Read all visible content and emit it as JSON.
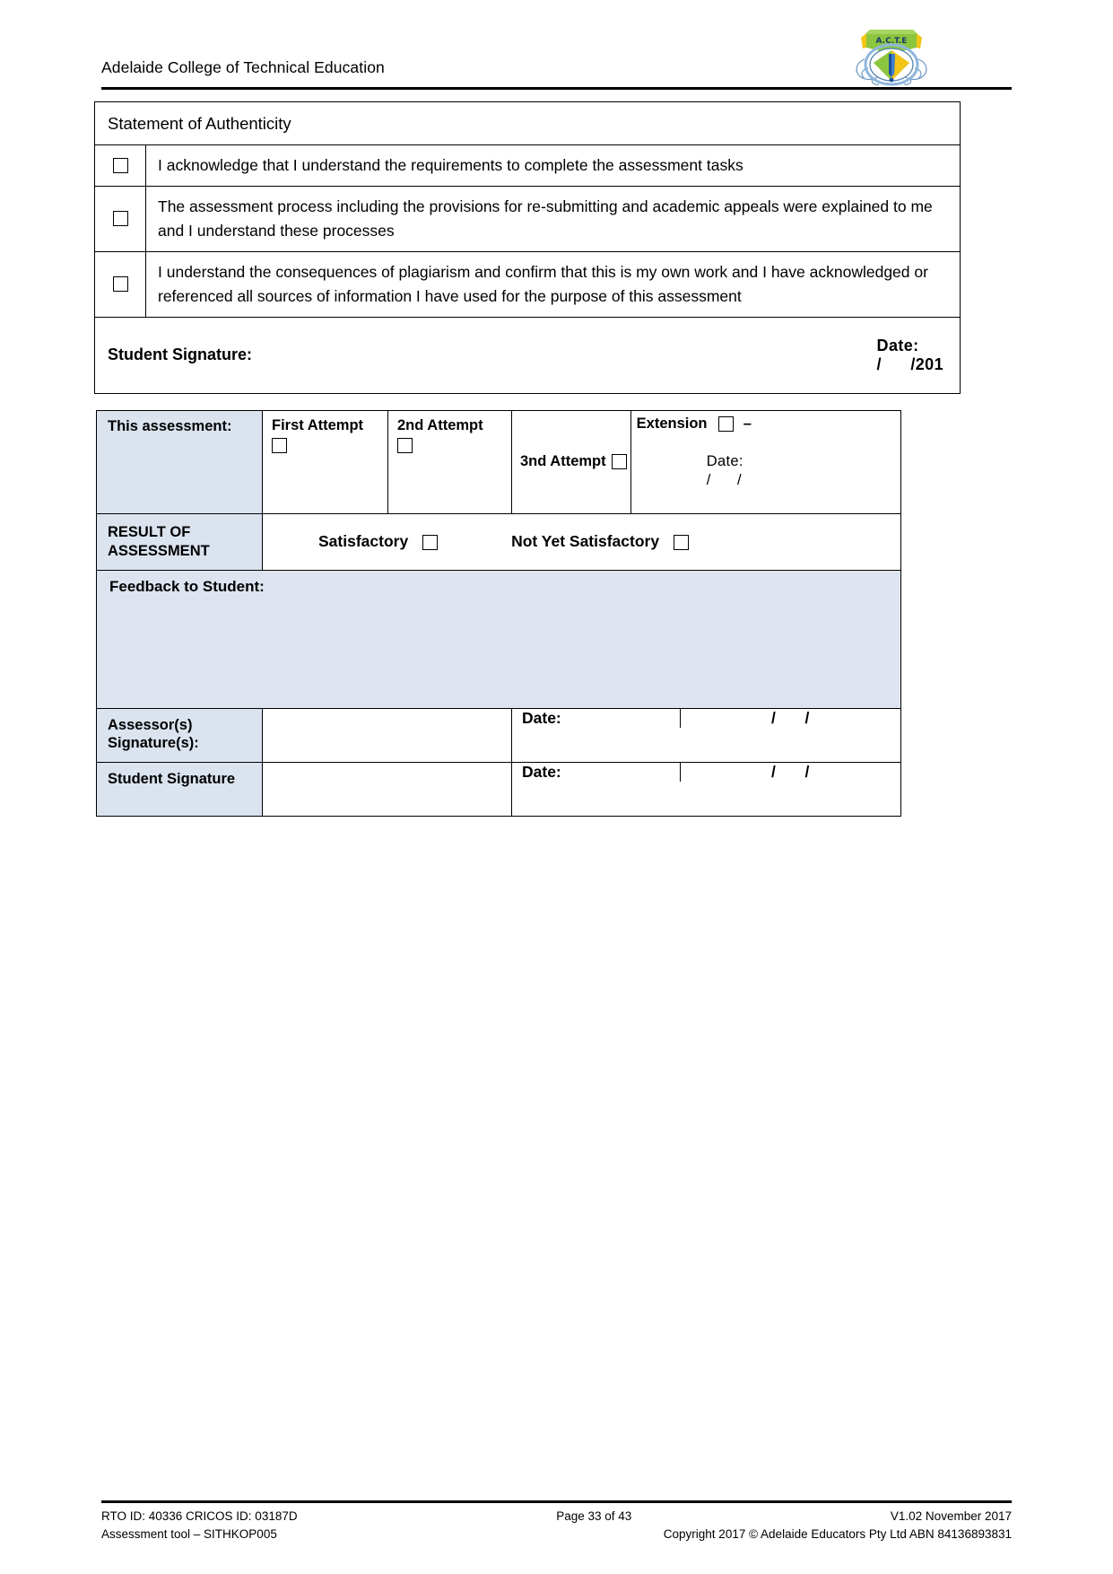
{
  "header": {
    "institution": "Adelaide College of Technical Education",
    "logo_icon": "college-crest-logo"
  },
  "authenticity": {
    "title": "Statement of Authenticity",
    "statements": [
      "I acknowledge that I understand the requirements to complete the assessment tasks",
      "The assessment process including the provisions for re-submitting and academic appeals were explained to me and I understand these processes",
      "I understand the consequences of plagiarism and confirm that this is my own work and I have acknowledged or referenced all sources of information I have used for the purpose of this assessment"
    ],
    "signature_label": "Student Signature:",
    "date_label": "Date:",
    "date_value": "/      /201"
  },
  "result_block": {
    "assessment_label": "This assessment:",
    "attempt_1": "First Attempt",
    "attempt_2": "2nd Attempt",
    "attempt_3": "3nd Attempt",
    "extension_label": "Extension",
    "extension_dash": "–",
    "extension_date_label": "Date:",
    "extension_date_value": "/      /",
    "result_label": "RESULT OF ASSESSMENT",
    "result_option_1": "Satisfactory",
    "result_option_2": "Not Yet Satisfactory",
    "feedback_label": "Feedback to Student:",
    "assessor_label": "Assessor(s) Signature(s):",
    "student_label": "Student Signature",
    "date_label": "Date:",
    "date_value": "/      /"
  },
  "footer": {
    "rto": "RTO ID: 40336 CRICOS ID: 03187D",
    "page": "Page 33 of 43",
    "version": "V1.02 November 2017",
    "tool": "Assessment tool – SITHKOP005",
    "copyright": "Copyright 2017 © Adelaide Educators Pty Ltd ABN 84136893831"
  },
  "colors": {
    "shade": "#dbe3ef",
    "feedback_shade": "#dde4f0",
    "border": "#000000"
  }
}
